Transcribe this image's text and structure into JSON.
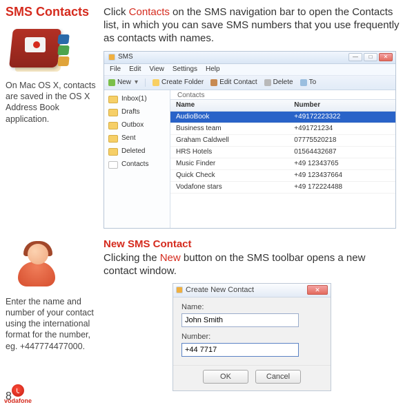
{
  "page_number": "8",
  "section1": {
    "title": "SMS Contacts",
    "body_pre": "Click ",
    "body_red": "Contacts",
    "body_post": " on the SMS navigation bar to open the Contacts list, in which you can save SMS numbers that you use frequently as contacts with names.",
    "sidebar_note": "On Mac OS X, contacts are saved in the OS X Address Book application."
  },
  "sms_window": {
    "title": "SMS",
    "menu": [
      "File",
      "Edit",
      "View",
      "Settings",
      "Help"
    ],
    "toolbar": {
      "new": "New",
      "create_folder": "Create Folder",
      "edit_contact": "Edit Contact",
      "delete": "Delete",
      "to": "To"
    },
    "folders": [
      {
        "label": "Inbox(1)"
      },
      {
        "label": "Drafts"
      },
      {
        "label": "Outbox"
      },
      {
        "label": "Sent"
      },
      {
        "label": "Deleted"
      },
      {
        "label": "Contacts"
      }
    ],
    "contacts_tab": "Contacts",
    "columns": {
      "name": "Name",
      "number": "Number"
    },
    "rows": [
      {
        "name": "AudioBook",
        "number": "+49172223322",
        "selected": true
      },
      {
        "name": "Business team",
        "number": "+491721234"
      },
      {
        "name": "Graham Caldwell",
        "number": "07775520218"
      },
      {
        "name": "HRS Hotels",
        "number": "01564432687"
      },
      {
        "name": "Music Finder",
        "number": "+49 12343765"
      },
      {
        "name": "Quick Check",
        "number": "+49 123437664"
      },
      {
        "name": "Vodafone stars",
        "number": "+49 172224488"
      }
    ],
    "brand": "vodafone",
    "win_min": "—",
    "win_max": "□",
    "win_close": "✕"
  },
  "section2": {
    "title": "New SMS Contact",
    "body_pre": "Clicking the ",
    "body_red": "New",
    "body_post": " button on the SMS toolbar opens a new contact window.",
    "sidebar_note": "Enter the name and number of your contact using the international format for the number, eg. +447774477000."
  },
  "dialog": {
    "title": "Create New Contact",
    "name_label": "Name:",
    "name_value": "John Smith",
    "number_label": "Number:",
    "number_value": "+44 7717",
    "ok": "OK",
    "cancel": "Cancel",
    "close": "✕"
  }
}
